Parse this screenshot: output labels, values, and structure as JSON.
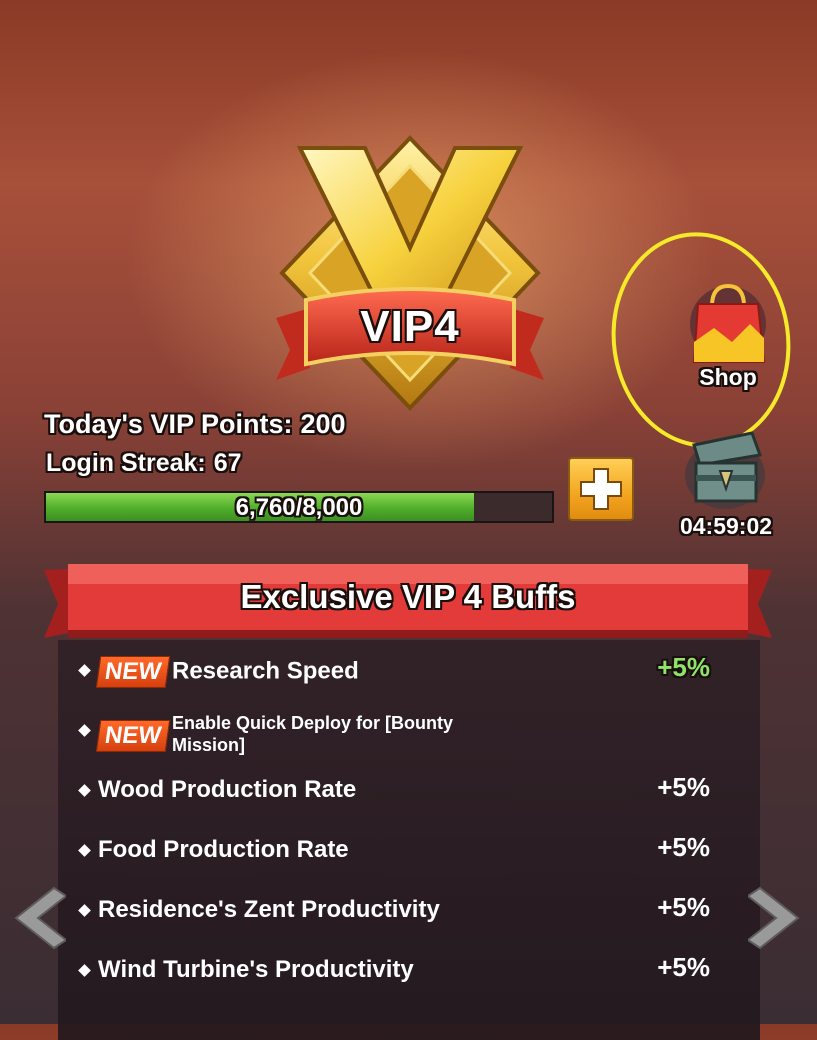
{
  "vip": {
    "level_label": "VIP4"
  },
  "stats": {
    "points_label": "Today's VIP Points:",
    "points_value": "200",
    "streak_label": "Login Streak:",
    "streak_value": "67"
  },
  "progress": {
    "text": "6,760/8,000",
    "fraction": 0.845
  },
  "shop": {
    "label": "Shop"
  },
  "chest": {
    "timer": "04:59:02"
  },
  "buffs": {
    "title": "Exclusive VIP 4 Buffs",
    "new_tag": "NEW",
    "items": [
      {
        "label": "Research Speed",
        "value": "+5%",
        "is_new": true
      },
      {
        "label": "Enable Quick Deploy for [Bounty Mission]",
        "value": "",
        "is_new": true
      },
      {
        "label": "Wood Production Rate",
        "value": "+5%",
        "is_new": false
      },
      {
        "label": "Food Production Rate",
        "value": "+5%",
        "is_new": false
      },
      {
        "label": "Residence's Zent Productivity",
        "value": "+5%",
        "is_new": false
      },
      {
        "label": "Wind Turbine's Productivity",
        "value": "+5%",
        "is_new": false
      }
    ]
  },
  "colors": {
    "annotation_circle": "#f4ea2a",
    "progress_fill": "#4fae2b",
    "new_value": "#8fe36b",
    "banner": "#e03a3a"
  }
}
